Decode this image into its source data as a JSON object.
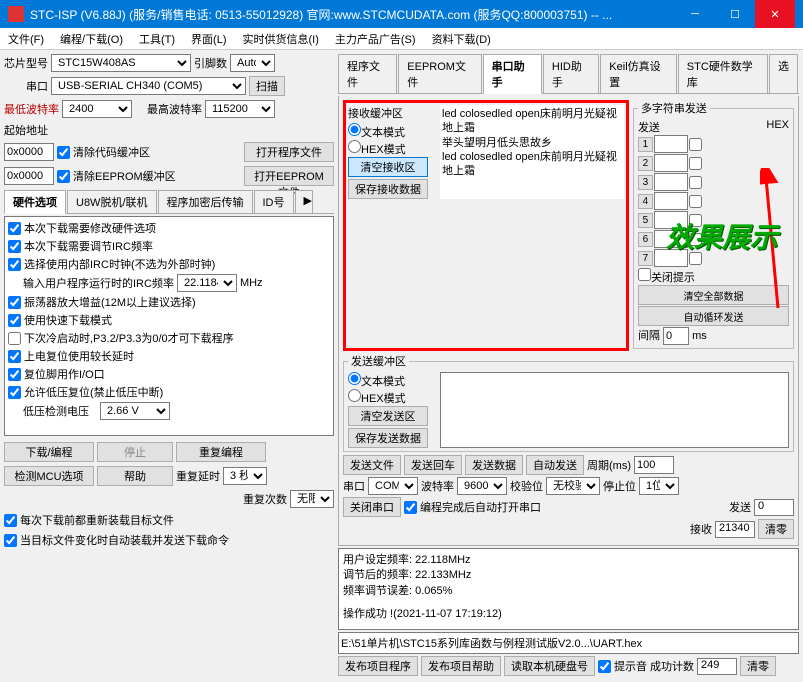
{
  "title": "STC-ISP (V6.88J) (服务/销售电话: 0513-55012928) 官网:www.STCMCUDATA.com (服务QQ:800003751) -- ...",
  "menu": [
    "文件(F)",
    "编程/下载(O)",
    "工具(T)",
    "界面(L)",
    "实时供货信息(I)",
    "主力产品广告(S)",
    "资料下载(D)"
  ],
  "chip": {
    "label": "芯片型号",
    "value": "STC15W408AS",
    "pins_label": "引脚数",
    "pins_value": "Auto"
  },
  "port": {
    "label": "串口",
    "value": "USB-SERIAL CH340 (COM5)",
    "scan": "扫描"
  },
  "baud": {
    "min_label": "最低波特率",
    "min": "2400",
    "max_label": "最高波特率",
    "max": "115200"
  },
  "addr": {
    "start_label": "起始地址",
    "code_addr": "0x0000",
    "code_chk": "清除代码缓冲区",
    "code_btn": "打开程序文件",
    "ee_addr": "0x0000",
    "ee_chk": "清除EEPROM缓冲区",
    "ee_btn": "打开EEPROM文件"
  },
  "hwtabs": [
    "硬件选项",
    "U8W脱机/联机",
    "程序加密后传输",
    "ID号"
  ],
  "hwopts": [
    {
      "c": true,
      "t": "本次下载需要修改硬件选项"
    },
    {
      "c": true,
      "t": "本次下载需要调节IRC频率"
    },
    {
      "c": true,
      "t": "选择使用内部IRC时钟(不选为外部时钟)"
    }
  ],
  "irc": {
    "label": "输入用户程序运行时的IRC频率",
    "value": "22.1184",
    "unit": "MHz"
  },
  "hwopts2": [
    {
      "c": true,
      "t": "振荡器放大增益(12M以上建议选择)"
    },
    {
      "c": true,
      "t": "使用快速下载模式"
    },
    {
      "c": false,
      "t": "下次冷启动时,P3.2/P3.3为0/0才可下载程序"
    },
    {
      "c": true,
      "t": "上电复位使用较长延时"
    },
    {
      "c": true,
      "t": "复位脚用作I/O口"
    },
    {
      "c": true,
      "t": "允许低压复位(禁止低压中断)"
    }
  ],
  "lowv": {
    "label": "低压检测电压",
    "value": "2.66 V"
  },
  "prog": {
    "dl": "下载/编程",
    "stop": "停止",
    "re": "重复编程",
    "detect": "检测MCU选项",
    "help": "帮助",
    "delay_label": "重复延时",
    "delay": "3 秒",
    "count_label": "重复次数",
    "count": "无限"
  },
  "bottom": [
    {
      "c": true,
      "t": "每次下载前都重新装载目标文件"
    },
    {
      "c": true,
      "t": "当目标文件变化时自动装载并发送下载命令"
    }
  ],
  "righttabs": [
    "程序文件",
    "EEPROM文件",
    "串口助手",
    "HID助手",
    "Keil仿真设置",
    "STC硬件数学库",
    "选"
  ],
  "recv": {
    "legend": "接收缓冲区",
    "text_mode": "文本模式",
    "hex_mode": "HEX模式",
    "clear": "清空接收区",
    "save": "保存接收数据"
  },
  "recv_text": "led colosedled open床前明月光疑视地上霜\n举头望明月低头思故乡\nled colosedled open床前明月光疑视地上霜",
  "send": {
    "legend": "发送缓冲区",
    "text_mode": "文本模式",
    "hex_mode": "HEX模式",
    "clear": "清空发送区",
    "save": "保存发送数据"
  },
  "sendbtns": {
    "file": "发送文件",
    "cr": "发送回车",
    "data": "发送数据",
    "auto": "自动发送",
    "period_label": "周期(ms)",
    "period": "100"
  },
  "serial2": {
    "port_label": "串口",
    "port": "COM5",
    "baud_label": "波特率",
    "baud": "9600",
    "parity_label": "校验位",
    "parity": "无校验",
    "stop_label": "停止位",
    "stop": "1位"
  },
  "serial3": {
    "close": "关闭串口",
    "autoopen": "编程完成后自动打开串口",
    "tx_label": "发送",
    "tx": "0",
    "rx_label": "接收",
    "rx": "21340",
    "clear": "清零"
  },
  "multi": {
    "legend": "多字符串发送",
    "send": "发送",
    "hex": "HEX",
    "close_chk": "关闭提示",
    "clear_all": "清空全部数据",
    "auto_cycle": "自动循环发送",
    "gap_label": "间隔",
    "gap": "0",
    "ms": "ms"
  },
  "log": {
    "l1": "用户设定频率: 22.118MHz",
    "l2": "调节后的频率: 22.133MHz",
    "l3": "频率调节误差: 0.065%",
    "l4": "操作成功 !(2021-11-07 17:19:12)"
  },
  "file": "E:\\51单片机\\STC15系列库函数与例程测试版V2.0...\\UART.hex",
  "status": {
    "elapsed_label": "发布项目程序",
    "disk_label": "发布项目帮助",
    "read_label": "读取本机硬盘号",
    "ok_label": "提示音",
    "count_label": "成功计数",
    "count": "249",
    "clear": "清零"
  },
  "effect": "效果展示"
}
